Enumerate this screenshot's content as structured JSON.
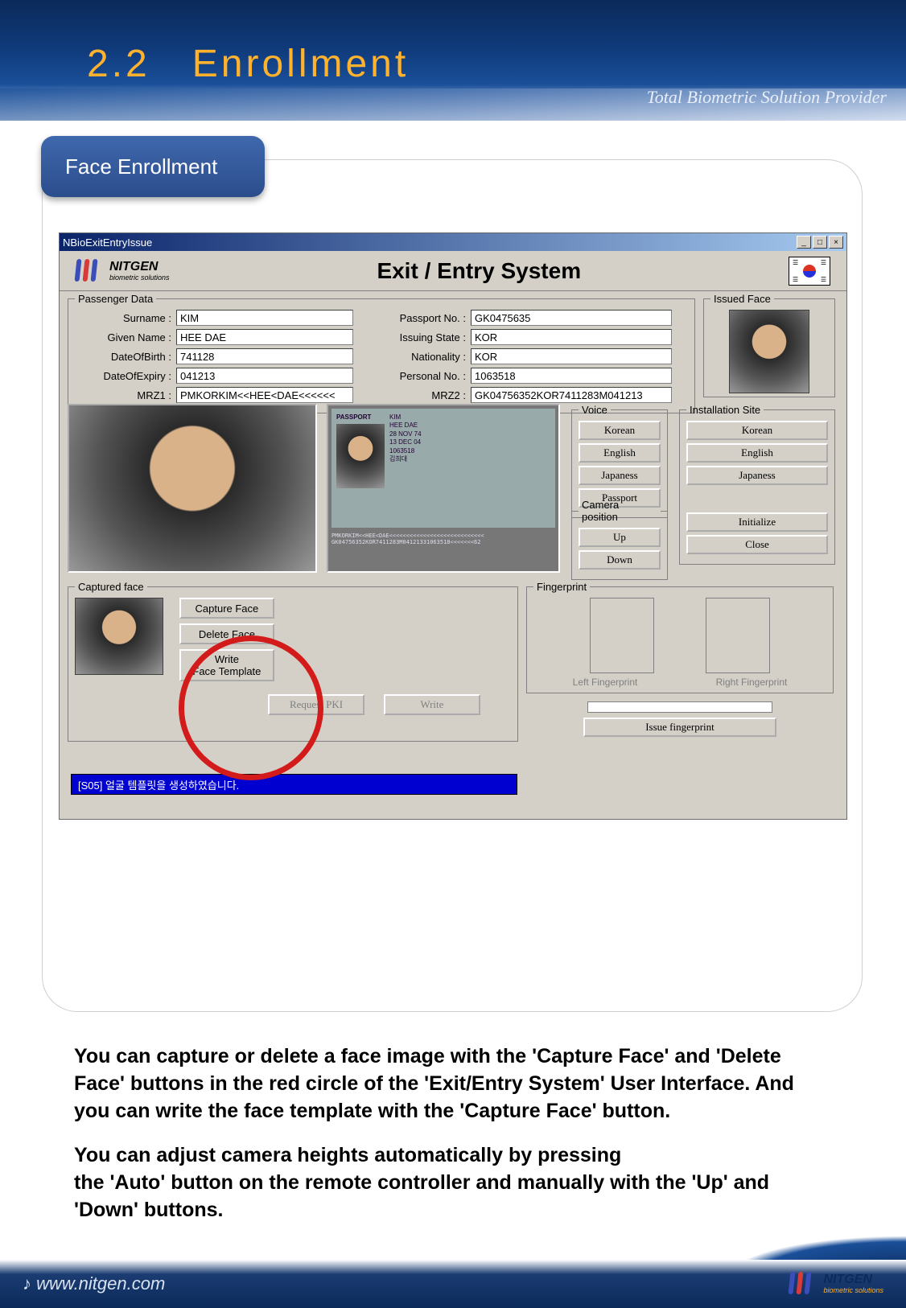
{
  "slide": {
    "section_number": "2.2",
    "section_title": "Enrollment",
    "tab_label": "Face Enrollment",
    "tagline": "Total Biometric Solution Provider"
  },
  "brand": {
    "name": "NITGEN",
    "subtitle": "biometric solutions"
  },
  "window": {
    "title": "NBioExitEntryIssue",
    "app_title": "Exit / Entry System",
    "flag": "Korea",
    "passenger_legend": "Passenger Data",
    "labels": {
      "surname": "Surname :",
      "given_name": "Given Name :",
      "dob": "DateOfBirth :",
      "doe": "DateOfExpiry :",
      "mrz1": "MRZ1 :",
      "passport_no": "Passport No. :",
      "issuing_state": "Issuing State :",
      "nationality": "Nationality :",
      "personal_no": "Personal No. :",
      "mrz2": "MRZ2 :"
    },
    "values": {
      "surname": "KIM",
      "given_name": "HEE DAE",
      "dob": "741128",
      "doe": "041213",
      "mrz1": "PMKORKIM<<HEE<DAE<<<<<<",
      "passport_no": "GK0475635",
      "issuing_state": "KOR",
      "nationality": "KOR",
      "personal_no": "1063518",
      "mrz2": "GK04756352KOR7411283M041213"
    },
    "passport_panel": {
      "header": "PASSPORT",
      "lines": [
        "KIM",
        "HEE DAE",
        "28 NOV 74",
        "13 DEC 04",
        "1063518",
        "김희대"
      ],
      "mrz_line1": "PMKORKIM<<HEE<DAE<<<<<<<<<<<<<<<<<<<<<<<<<<<<",
      "mrz_line2": "GK04756352KOR7411283M04121331063518<<<<<<<62"
    },
    "issued_face_legend": "Issued Face",
    "voice": {
      "legend": "Voice",
      "options": [
        "Korean",
        "English",
        "Japaness",
        "Passport"
      ]
    },
    "camera_position": {
      "legend": "Camera position",
      "options": [
        "Up",
        "Down"
      ]
    },
    "installation_site": {
      "legend": "Installation Site",
      "options": [
        "Korean",
        "English",
        "Japaness"
      ],
      "actions": [
        "Initialize",
        "Close"
      ]
    },
    "captured_face": {
      "legend": "Captured face",
      "buttons": {
        "capture": "Capture Face",
        "delete": "Delete Face",
        "write_template": "Write\nFace Template"
      },
      "op_buttons": {
        "request": "Request PKI",
        "write": "Write"
      }
    },
    "fingerprint": {
      "legend": "Fingerprint",
      "left": "Left Fingerprint",
      "right": "Right Fingerprint",
      "issue": "Issue fingerprint"
    },
    "status_message": "[S05] 얼굴 템플릿을 생성하였습니다."
  },
  "description": {
    "p1_a": "You can capture or delete a face image with the '",
    "p1_b1": "Capture Face",
    "p1_c": "' and '",
    "p1_b2": "Delete Face",
    "p1_d": "' buttons in the red circle of  the '",
    "p1_b3": "Exit/Entry System",
    "p1_e": "' User Interface. And you can write the face template with the '",
    "p1_b4": "Capture Face",
    "p1_f": "' button.",
    "p2_a": "You can adjust camera heights automatically by pressing",
    "p2_b": "the '",
    "p2_b1": "Auto",
    "p2_c": "' button on the remote controller and manually with the '",
    "p2_b2": "Up",
    "p2_d": "' and '",
    "p2_b3": "Down",
    "p2_e": "' buttons."
  },
  "footer": {
    "url": "www.nitgen.com"
  }
}
